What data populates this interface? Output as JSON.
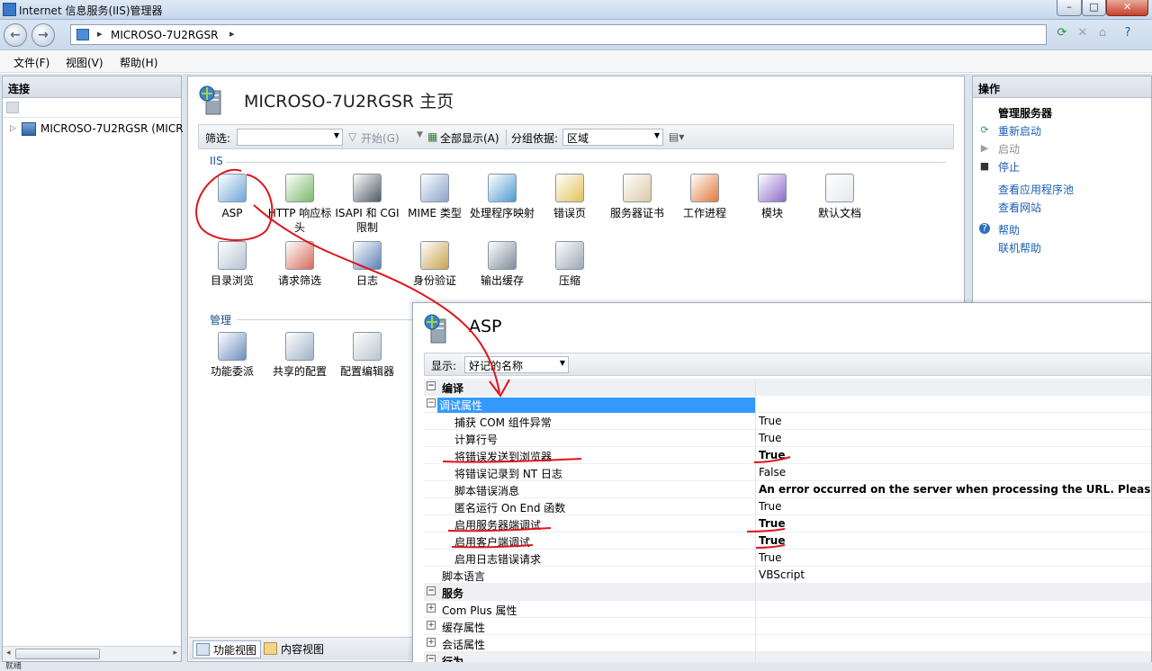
{
  "window": {
    "title": "Internet 信息服务(IIS)管理器"
  },
  "address": {
    "server": "MICROSO-7U2RGSR",
    "sep": "▸"
  },
  "menu": {
    "file": "文件(F)",
    "view": "视图(V)",
    "help": "帮助(H)"
  },
  "connections": {
    "header": "连接",
    "tree_server": "MICROSO-7U2RGSR (MICR"
  },
  "home": {
    "title": "MICROSO-7U2RGSR 主页",
    "filter_label": "筛选:",
    "start_label": "开始(G)",
    "show_all_label": "全部显示(A)",
    "group_by_label": "分组依据:",
    "group_by_value": "区域",
    "group_iis": "IIS",
    "group_manage": "管理",
    "features": [
      {
        "label": "ASP",
        "color": "#6ea6d8"
      },
      {
        "label": "HTTP 响应标头",
        "color": "#7cb86b"
      },
      {
        "label": "ISAPI 和 CGI 限制",
        "color": "#505a66"
      },
      {
        "label": "MIME 类型",
        "color": "#8aa3c9"
      },
      {
        "label": "处理程序映射",
        "color": "#4e9cd1"
      },
      {
        "label": "错误页",
        "color": "#e3c25a"
      },
      {
        "label": "服务器证书",
        "color": "#d9c9a8"
      },
      {
        "label": "工作进程",
        "color": "#e0793a"
      },
      {
        "label": "模块",
        "color": "#8c6bc7"
      },
      {
        "label": "默认文档",
        "color": "#e5e8ec"
      },
      {
        "label": "目录浏览",
        "color": "#b5c3d3"
      },
      {
        "label": "请求筛选",
        "color": "#d66a5a"
      },
      {
        "label": "日志",
        "color": "#5e7fb6"
      },
      {
        "label": "身份验证",
        "color": "#caa24e"
      },
      {
        "label": "输出缓存",
        "color": "#7e8c9b"
      },
      {
        "label": "压缩",
        "color": "#9aa8b4"
      }
    ],
    "manage_features": [
      {
        "label": "功能委派",
        "color": "#6c8fc0"
      },
      {
        "label": "共享的配置",
        "color": "#9fb2c6"
      },
      {
        "label": "配置编辑器",
        "color": "#b9c4cf"
      }
    ],
    "view_features": "功能视图",
    "view_content": "内容视图"
  },
  "actions": {
    "header": "操作",
    "manage_server": "管理服务器",
    "restart": "重新启动",
    "start": "启动",
    "stop": "停止",
    "view_app_pools": "查看应用程序池",
    "view_sites": "查看网站",
    "help": "帮助",
    "online_help": "联机帮助"
  },
  "asp": {
    "title": "ASP",
    "display_label": "显示:",
    "display_value": "好记的名称",
    "rows": [
      {
        "type": "cat",
        "toggle": "⊟",
        "name": "编译",
        "value": ""
      },
      {
        "type": "sel",
        "toggle": "⊟",
        "name": "调试属性",
        "value": ""
      },
      {
        "type": "child",
        "toggle": "",
        "name": "捕获 COM 组件异常",
        "value": "True",
        "bold": false
      },
      {
        "type": "child",
        "toggle": "",
        "name": "计算行号",
        "value": "True",
        "bold": false
      },
      {
        "type": "child",
        "toggle": "",
        "name": "将错误发送到浏览器",
        "value": "True",
        "bold": true
      },
      {
        "type": "child",
        "toggle": "",
        "name": "将错误记录到 NT 日志",
        "value": "False",
        "bold": false
      },
      {
        "type": "child",
        "toggle": "",
        "name": "脚本错误消息",
        "value": "An error occurred on the server when processing the URL. Please contac",
        "bold": true
      },
      {
        "type": "child",
        "toggle": "",
        "name": "匿名运行 On End 函数",
        "value": "True",
        "bold": false
      },
      {
        "type": "child",
        "toggle": "",
        "name": "启用服务器端调试",
        "value": "True",
        "bold": true
      },
      {
        "type": "child",
        "toggle": "",
        "name": "启用客户端调试",
        "value": "True",
        "bold": true
      },
      {
        "type": "child",
        "toggle": "",
        "name": "启用日志错误请求",
        "value": "True",
        "bold": false
      },
      {
        "type": "plain",
        "toggle": "",
        "name": "脚本语言",
        "value": "VBScript",
        "bold": false
      },
      {
        "type": "cat",
        "toggle": "⊟",
        "name": "服务",
        "value": ""
      },
      {
        "type": "plain",
        "toggle": "⊞",
        "name": "Com Plus 属性",
        "value": ""
      },
      {
        "type": "plain",
        "toggle": "⊞",
        "name": "缓存属性",
        "value": ""
      },
      {
        "type": "plain",
        "toggle": "⊞",
        "name": "会话属性",
        "value": ""
      },
      {
        "type": "cat",
        "toggle": "⊟",
        "name": "行为",
        "value": ""
      }
    ]
  },
  "status": {
    "text": "就绪"
  }
}
